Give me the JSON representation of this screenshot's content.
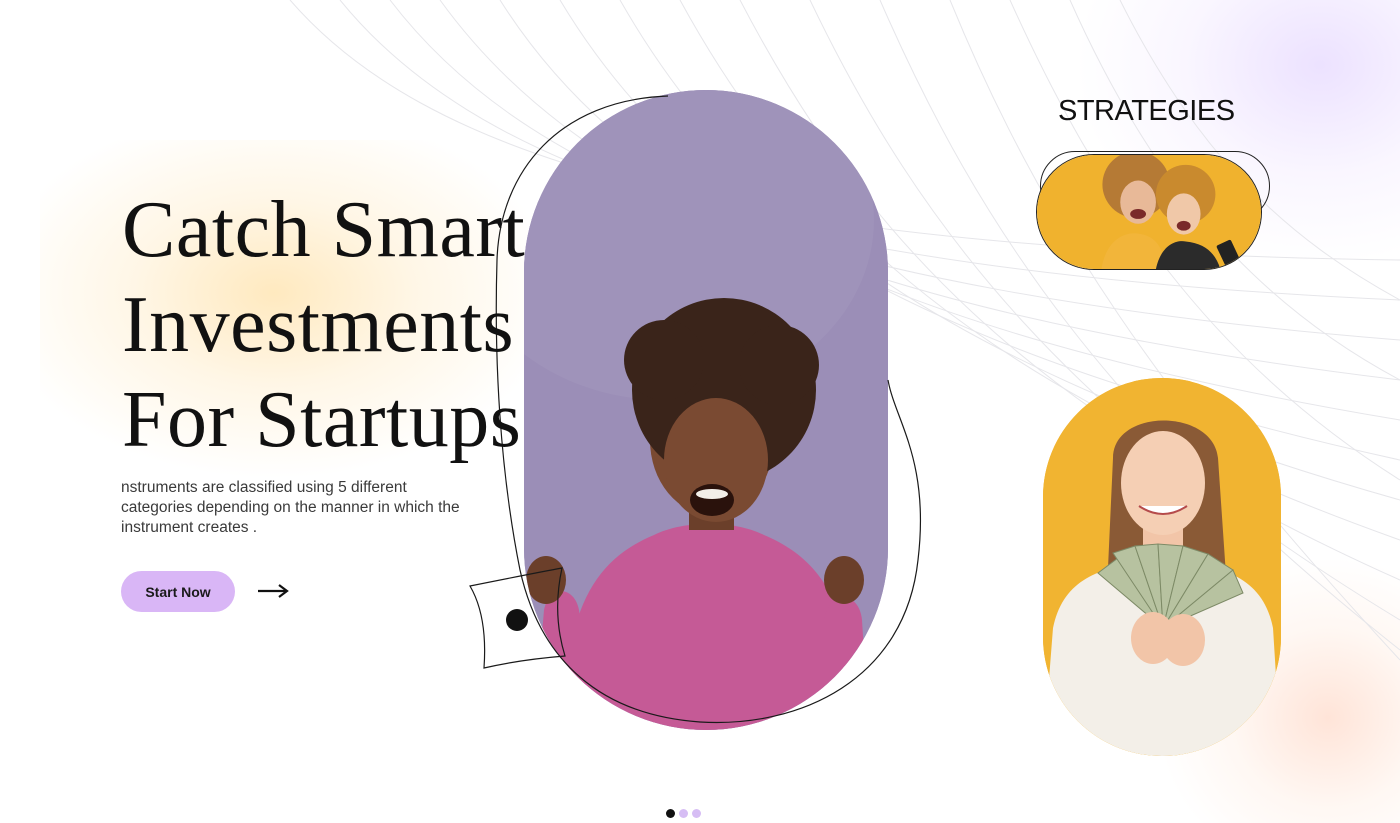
{
  "hero": {
    "headline_lines": [
      "Catch Smart",
      "Investments",
      "For Startups"
    ],
    "description": "nstruments are classified using 5 different categories depending on the manner in which the instrument creates .",
    "cta_label": "Start Now"
  },
  "side": {
    "strategies_label": "STRATEGIES"
  },
  "icons": [
    "arrow-right-icon"
  ],
  "carousel": {
    "total": 3,
    "active_index": 0
  },
  "colors": {
    "cta_background": "#d9b6f6",
    "main_photo_background": "#9b8eb7",
    "accent_yellow": "#f1b431",
    "heading_text": "#111111",
    "dot_inactive": "#d6bdf4",
    "dot_active": "#111111"
  }
}
